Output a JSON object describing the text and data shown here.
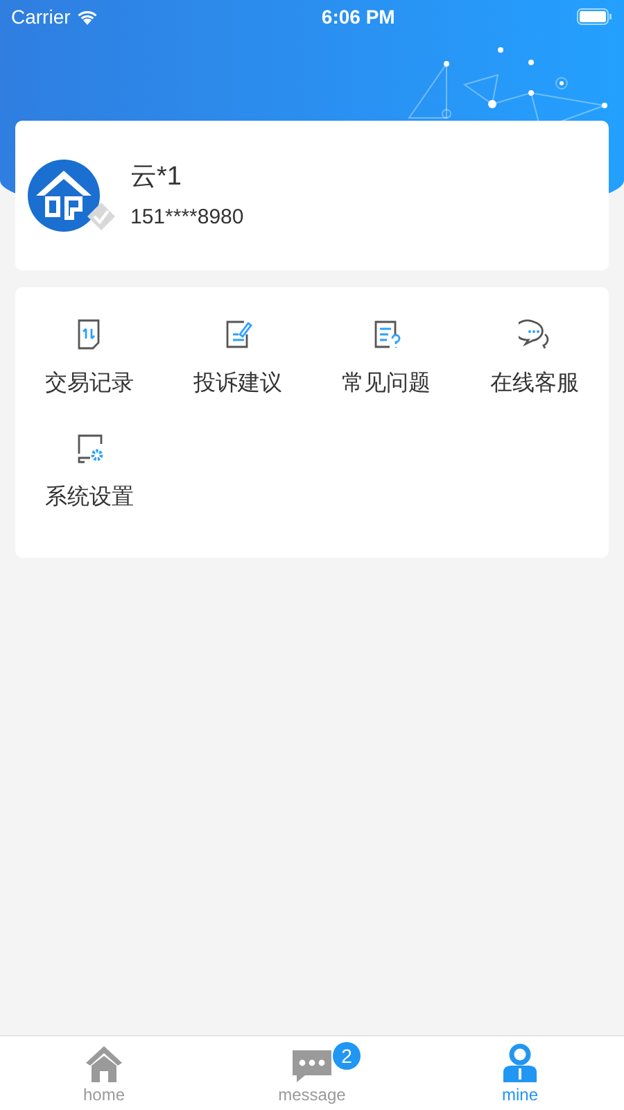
{
  "status_bar": {
    "carrier": "Carrier",
    "time": "6:06 PM"
  },
  "profile": {
    "name": "云*1",
    "phone": "151****8980",
    "verified": false
  },
  "menu": [
    {
      "kind": "records",
      "label": "交易记录"
    },
    {
      "kind": "complaint",
      "label": "投诉建议"
    },
    {
      "kind": "faq",
      "label": "常见问题"
    },
    {
      "kind": "chat",
      "label": "在线客服"
    },
    {
      "kind": "settings",
      "label": "系统设置"
    }
  ],
  "tabs": [
    {
      "kind": "home",
      "label": "home",
      "selected": false
    },
    {
      "kind": "message",
      "label": "message",
      "selected": false,
      "badge": "2"
    },
    {
      "kind": "mine",
      "label": "mine",
      "selected": true
    }
  ]
}
